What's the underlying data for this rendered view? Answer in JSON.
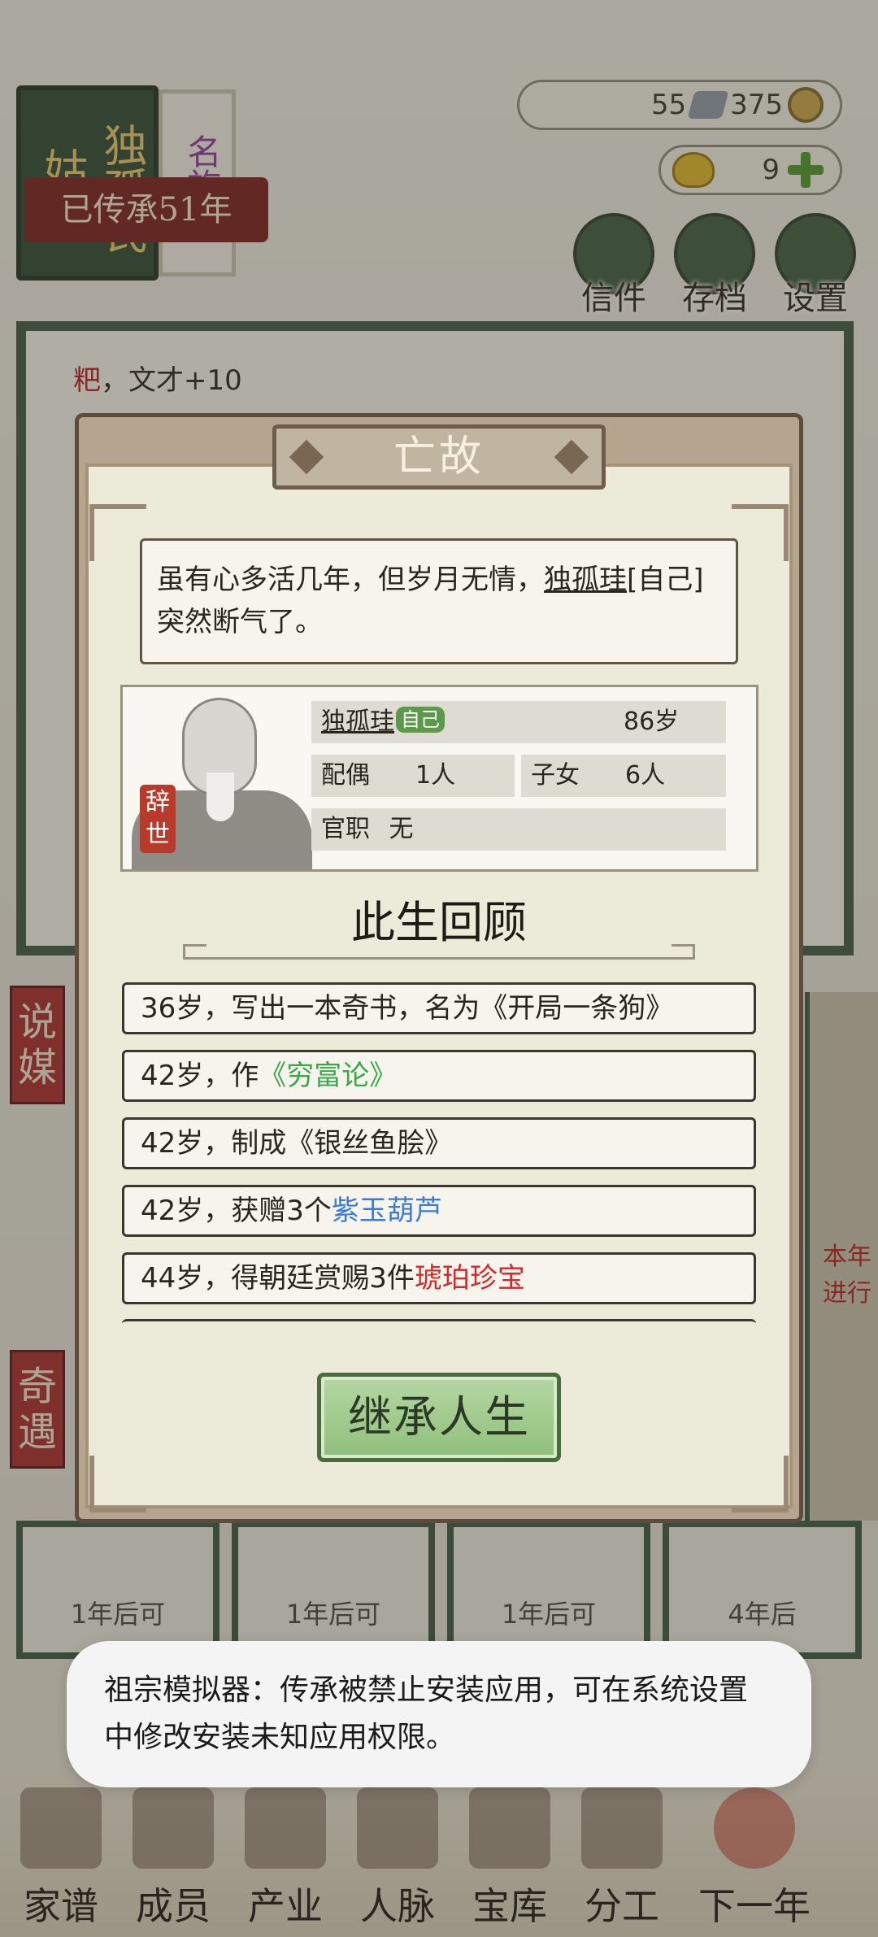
{
  "header": {
    "clan_name_col1": "姑孰",
    "clan_name_col2": "独孤氏",
    "clan_tag": "名族",
    "inherit_years": "已传承51年",
    "silver": "55",
    "coins": "375",
    "gold": "9",
    "buttons": [
      "信件",
      "存档",
      "设置"
    ]
  },
  "background": {
    "log_prefix": "粑",
    "log_rest": "，文才+10",
    "side_tabs": [
      "说媒",
      "奇遇"
    ],
    "cards": [
      "1年后可",
      "1年后可",
      "1年后可",
      "4年后"
    ],
    "right_strip": [
      "本年",
      "进行",
      "进行"
    ],
    "bottom_nav": [
      "家谱",
      "成员",
      "产业",
      "人脉",
      "宝库",
      "分工",
      "下一年"
    ]
  },
  "modal": {
    "title": "亡故",
    "message_pre": "虽有心多活几年，但岁月无情，",
    "message_name": "独孤珪",
    "message_post": "[自己]突然断气了。",
    "profile": {
      "name": "独孤珪",
      "self_tag": "自己",
      "age": "86岁",
      "spouse_label": "配偶",
      "spouse_value": "1人",
      "children_label": "子女",
      "children_value": "6人",
      "office_label": "官职",
      "office_value": "无",
      "seal": "辞世"
    },
    "review_title": "此生回顾",
    "events": [
      {
        "pre": "36岁，写出一本奇书，名为《开局一条狗》",
        "hl": ""
      },
      {
        "pre": "42岁，作",
        "hl": "《穷富论》"
      },
      {
        "pre": "42岁，制成《银丝鱼脍》",
        "hl": ""
      },
      {
        "pre": "42岁，获赠3个",
        "hl": "紫玉葫芦"
      },
      {
        "pre": "44岁，得朝廷赏赐3件",
        "hl": "琥珀珍宝"
      }
    ],
    "inherit_button": "继承人生"
  },
  "toast": {
    "text": "祖宗模拟器：传承被禁止安装应用，可在系统设置中修改安装未知应用权限。"
  },
  "colors": {
    "highlight_green": "#3aa84a",
    "highlight_blue": "#3b7bd6",
    "highlight_red": "#d12a2a",
    "button_green": "#8fbf7a"
  }
}
